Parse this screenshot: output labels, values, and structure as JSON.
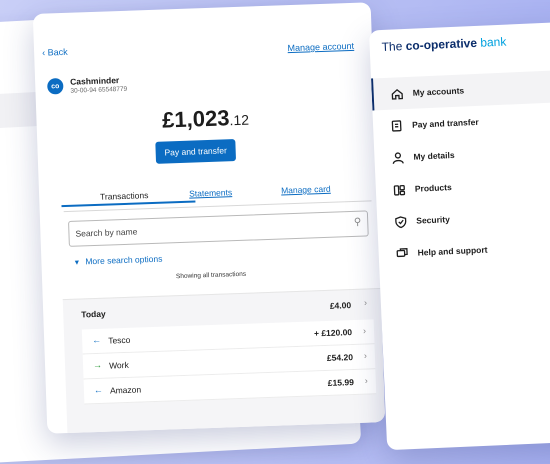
{
  "account_view": {
    "back_label": "Back",
    "manage_account_label": "Manage account",
    "account": {
      "badge": "co",
      "name": "Cashminder",
      "numbers": "30-00-94  65548779"
    },
    "balance": {
      "pounds": "£1,023",
      "pence": ".12"
    },
    "pay_button_label": "Pay and transfer",
    "tabs": [
      {
        "label": "Transactions"
      },
      {
        "label": "Statements"
      },
      {
        "label": "Manage card"
      }
    ],
    "search": {
      "placeholder": "Search by name"
    },
    "more_options_label": "More search options",
    "showing_label": "Showing all transactions",
    "today": {
      "label": "Today",
      "amount": "£4.00"
    },
    "transactions": [
      {
        "name": "Tesco",
        "amount": "+ £120.00",
        "direction": "in",
        "arrow": "←",
        "color": "#0b6cc2"
      },
      {
        "name": "Work",
        "amount": "£54.20",
        "direction": "out",
        "arrow": "→",
        "color": "#2e9a3a"
      },
      {
        "name": "Amazon",
        "amount": "£15.99",
        "direction": "in",
        "arrow": "←",
        "color": "#0b6cc2"
      }
    ]
  },
  "sidebar": {
    "logo": {
      "prefix": "The ",
      "brand": "co-operative",
      "suffix": " bank"
    },
    "items": [
      {
        "label": "My accounts",
        "icon": "home-icon"
      },
      {
        "label": "Pay and transfer",
        "icon": "pay-transfer-icon"
      },
      {
        "label": "My details",
        "icon": "person-icon"
      },
      {
        "label": "Products",
        "icon": "products-icon"
      },
      {
        "label": "Security",
        "icon": "shield-icon"
      },
      {
        "label": "Help and support",
        "icon": "chat-icon"
      }
    ]
  },
  "colors": {
    "accent": "#0b6cc2",
    "brand": "#0b2d6b",
    "background": "#b3bbf3"
  }
}
